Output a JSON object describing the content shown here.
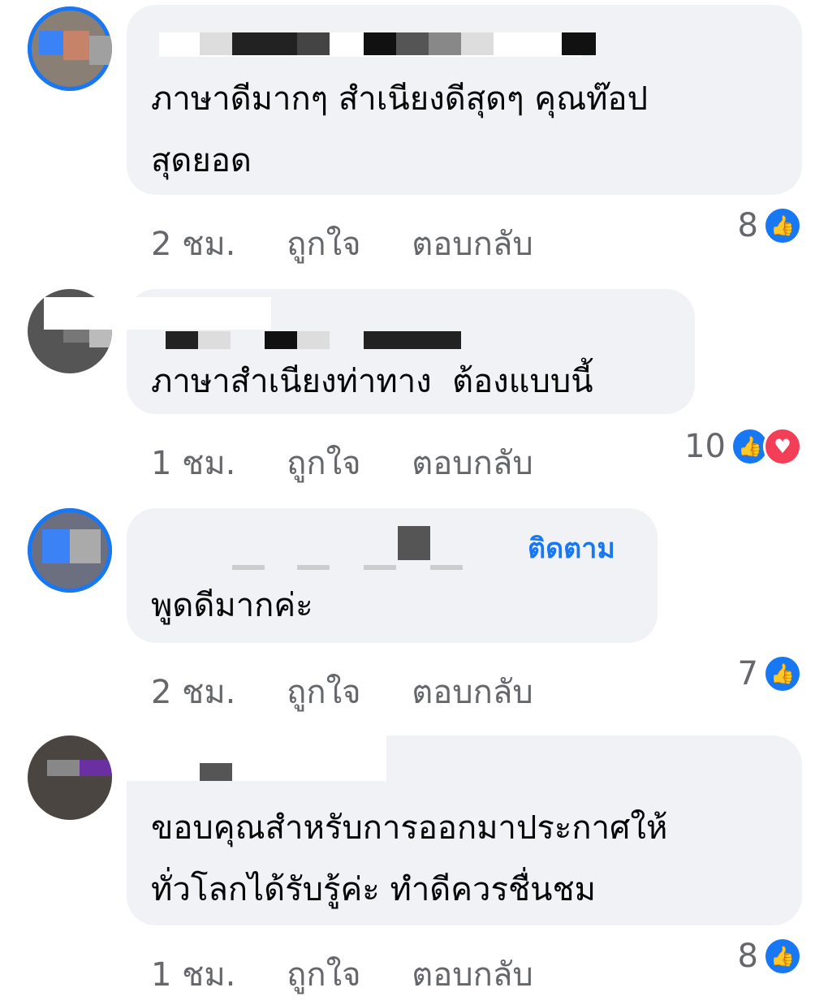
{
  "comments": [
    {
      "text": "ภาษาดีมากๆ สำเนียงดีสุดๆ คุณท๊อป\nสุดยอด",
      "time": "2 ชม.",
      "like_label": "ถูกใจ",
      "reply_label": "ตอบกลับ",
      "reaction_count": "8",
      "reactions": [
        "like-icon"
      ]
    },
    {
      "text": "ภาษาสำเนียงท่าทาง  ต้องแบบนี้",
      "time": "1 ชม.",
      "like_label": "ถูกใจ",
      "reply_label": "ตอบกลับ",
      "reaction_count": "10",
      "reactions": [
        "like-icon",
        "heart-icon"
      ]
    },
    {
      "follow_label": "ติดตาม",
      "text": "พูดดีมากค่ะ",
      "time": "2 ชม.",
      "like_label": "ถูกใจ",
      "reply_label": "ตอบกลับ",
      "reaction_count": "7",
      "reactions": [
        "like-icon"
      ]
    },
    {
      "text": "ขอบคุณสำหรับการออกมาประกาศให้\nทั่วโลกได้รับรู้ค่ะ ทำดีควรชื่นชม",
      "time": "1 ชม.",
      "like_label": "ถูกใจ",
      "reply_label": "ตอบกลับ",
      "reaction_count": "8",
      "reactions": [
        "like-icon"
      ]
    }
  ],
  "colors": {
    "bubble": "#f0f2f5",
    "accent": "#1877f2",
    "muted_text": "#65676b",
    "heart": "#f33e58"
  }
}
